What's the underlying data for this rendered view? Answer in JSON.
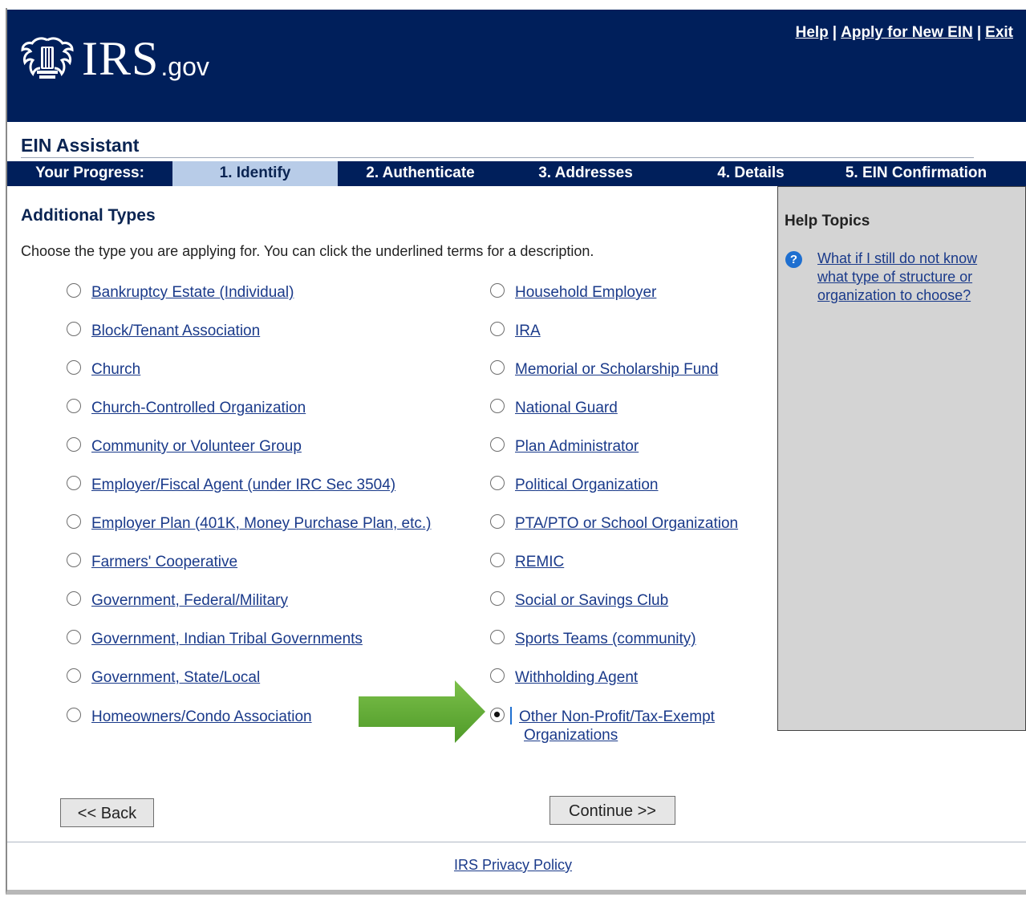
{
  "header": {
    "logo_irs": "IRS",
    "logo_gov": ".gov",
    "links": [
      "Help",
      "Apply for New EIN",
      "Exit"
    ],
    "separator": "|"
  },
  "assistant_title": "EIN Assistant",
  "progress": {
    "label": "Your Progress:",
    "steps": [
      "1. Identify",
      "2. Authenticate",
      "3. Addresses",
      "4. Details",
      "5. EIN Confirmation"
    ],
    "active_step": "1. Identify"
  },
  "main": {
    "heading": "Additional Types",
    "instructions": "Choose the type you are applying for. You can click the underlined terms for a description.",
    "left_options": [
      "Bankruptcy Estate (Individual)",
      "Block/Tenant Association",
      "Church",
      "Church-Controlled Organization",
      "Community or Volunteer Group",
      "Employer/Fiscal Agent (under IRC Sec 3504)",
      "Employer Plan (401K, Money Purchase Plan, etc.)",
      "Farmers' Cooperative",
      "Government, Federal/Military",
      "Government, Indian Tribal Governments",
      "Government, State/Local",
      "Homeowners/Condo Association"
    ],
    "right_options": [
      "Household Employer",
      "IRA",
      "Memorial or Scholarship Fund",
      "National Guard",
      "Plan Administrator",
      "Political Organization",
      "PTA/PTO or School Organization",
      "REMIC",
      "Social or Savings Club",
      "Sports Teams (community)",
      "Withholding Agent"
    ],
    "selected_option_line1": "Other Non-Profit/Tax-Exempt",
    "selected_option_line2": "Organizations",
    "back_button": "<< Back",
    "continue_button": "Continue >>"
  },
  "help": {
    "title": "Help Topics",
    "icon": "?",
    "link": "What if I still do not know what type of structure or organization to choose?"
  },
  "footer": {
    "privacy": "IRS Privacy Policy"
  },
  "colors": {
    "header_bg": "#001f5b",
    "progress_active": "#b8cce8",
    "link": "#1a3a8a",
    "help_panel": "#d4d4d4",
    "arrow": "#5aa52b"
  }
}
